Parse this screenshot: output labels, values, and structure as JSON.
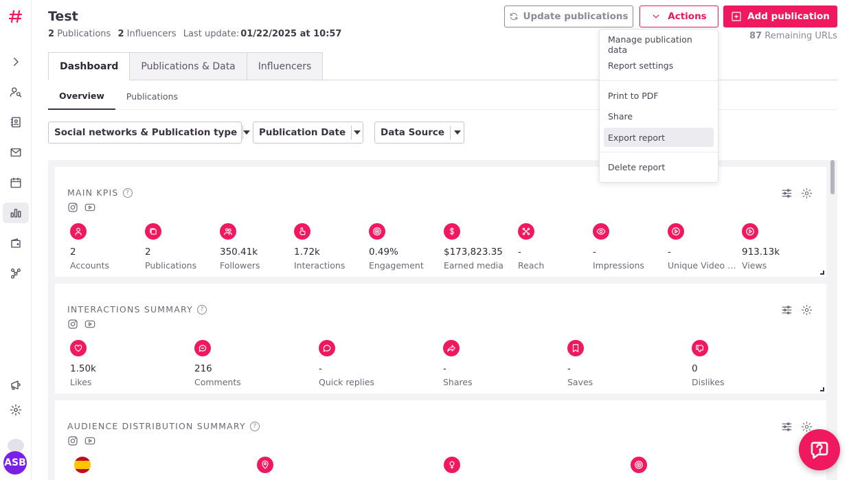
{
  "header": {
    "title": "Test",
    "publications_count": "2",
    "publications_label": "Publications",
    "influencers_count": "2",
    "influencers_label": "Influencers",
    "last_update_label": "Last update:",
    "last_update_value": "01/22/2025 at 10:57",
    "update_button": "Update publications",
    "actions_button": "Actions",
    "add_button": "Add publication",
    "remaining_count": "87",
    "remaining_label": "Remaining URLs"
  },
  "tabs": [
    {
      "label": "Dashboard",
      "active": true
    },
    {
      "label": "Publications & Data",
      "active": false
    },
    {
      "label": "Influencers",
      "active": false
    }
  ],
  "subtabs": [
    {
      "label": "Overview",
      "active": true
    },
    {
      "label": "Publications",
      "active": false
    }
  ],
  "filters": {
    "social": "Social networks & Publication type",
    "date": "Publication Date",
    "source": "Data Source"
  },
  "actions_menu": {
    "items": [
      "Manage publication data",
      "Report settings",
      "Print to PDF",
      "Share",
      "Export report",
      "Delete report"
    ],
    "hovered": "Export report"
  },
  "main_kpis": {
    "title": "MAIN KPIS",
    "items": [
      {
        "icon": "user-icon",
        "value": "2",
        "label": "Accounts"
      },
      {
        "icon": "publications-icon",
        "value": "2",
        "label": "Publications"
      },
      {
        "icon": "followers-icon",
        "value": "350.41k",
        "label": "Followers"
      },
      {
        "icon": "hand-pointer-icon",
        "value": "1.72k",
        "label": "Interactions"
      },
      {
        "icon": "target-icon",
        "value": "0.49%",
        "label": "Engagement"
      },
      {
        "icon": "dollar-icon",
        "value": "$173,823.35",
        "label": "Earned media"
      },
      {
        "icon": "reach-icon",
        "value": "-",
        "label": "Reach"
      },
      {
        "icon": "eye-icon",
        "value": "-",
        "label": "Impressions"
      },
      {
        "icon": "play-icon",
        "value": "-",
        "label": "Unique Video Views"
      },
      {
        "icon": "play-icon",
        "value": "913.13k",
        "label": "Views"
      }
    ]
  },
  "interactions_summary": {
    "title": "INTERACTIONS SUMMARY",
    "items": [
      {
        "icon": "heart-icon",
        "value": "1.50k",
        "label": "Likes"
      },
      {
        "icon": "comment-icon",
        "value": "216",
        "label": "Comments"
      },
      {
        "icon": "quick-reply-icon",
        "value": "-",
        "label": "Quick replies"
      },
      {
        "icon": "share-icon",
        "value": "-",
        "label": "Shares"
      },
      {
        "icon": "bookmark-icon",
        "value": "-",
        "label": "Saves"
      },
      {
        "icon": "dislike-icon",
        "value": "0",
        "label": "Dislikes"
      }
    ]
  },
  "audience_summary": {
    "title": "AUDIENCE DISTRIBUTION SUMMARY"
  },
  "user": {
    "initials": "ASB"
  },
  "colors": {
    "accent": "#f0185f",
    "avatar": "#7a1fe6"
  }
}
